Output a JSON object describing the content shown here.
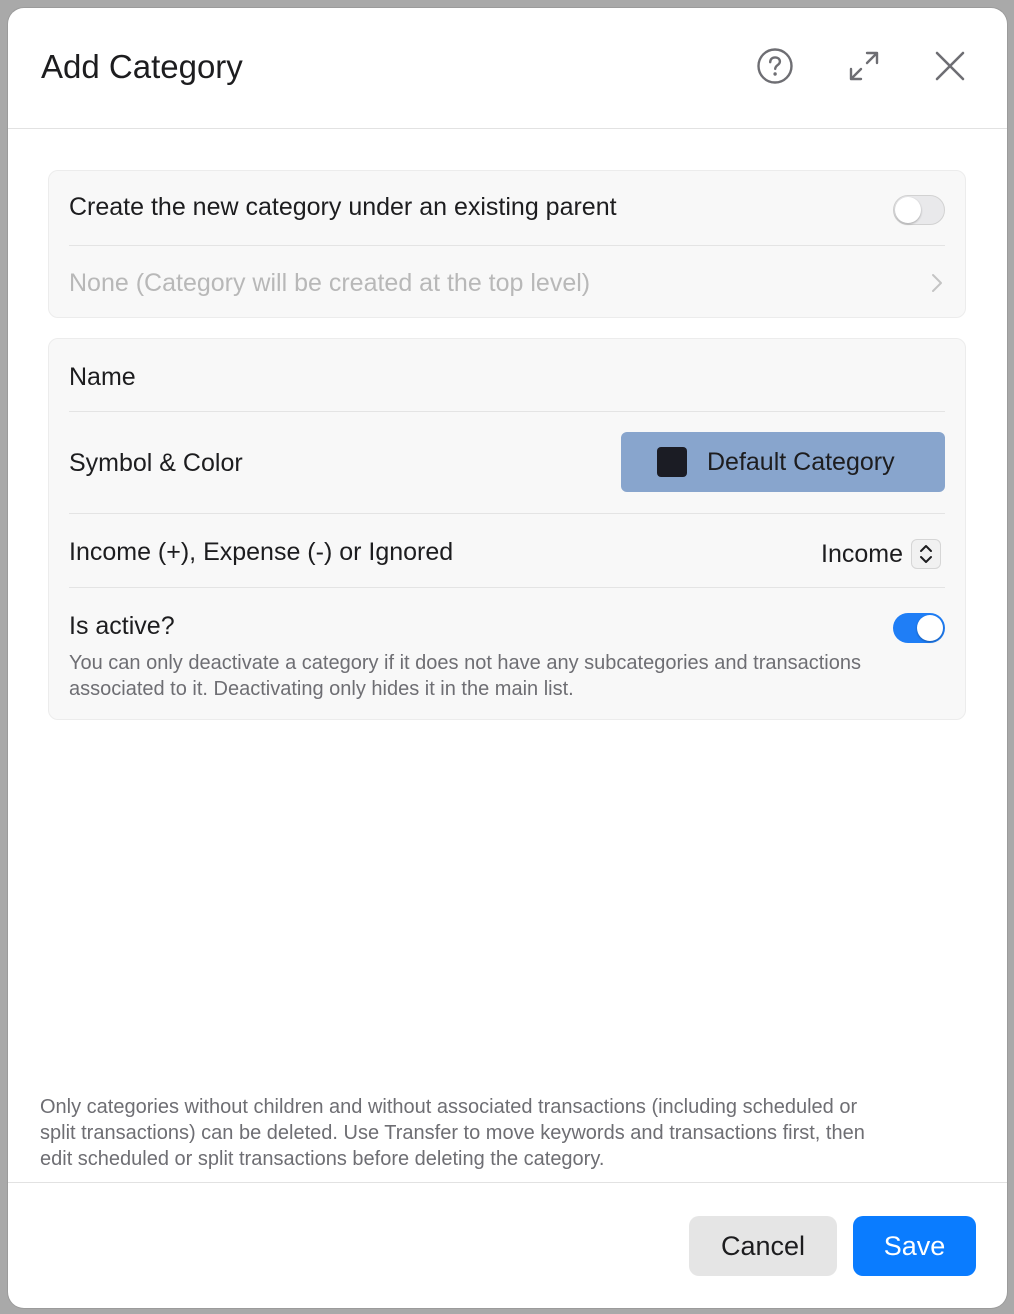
{
  "dialog": {
    "title": "Add Category",
    "icons": [
      "help-icon",
      "expand-icon",
      "close-icon"
    ]
  },
  "parent_section": {
    "toggle_label": "Create the new category under an existing parent",
    "toggle_on": false,
    "parent_value": "None (Category will be created at the top level)"
  },
  "details": {
    "name_label": "Name",
    "name_value": "",
    "symbol_label": "Symbol & Color",
    "symbol_button_label": "Default Category",
    "symbol_color": "#1b1c24",
    "button_color": "#88a5cd",
    "type_label": "Income (+), Expense (-) or Ignored",
    "type_value": "Income",
    "active_label": "Is active?",
    "active_on": true,
    "active_note_line1": "You can only deactivate a category if it does not have any subcategories and transactions",
    "active_note_line2": "associated to it. Deactivating only hides it in the main list."
  },
  "footer": {
    "delete_note_line1": "Only categories without children and without associated transactions (including scheduled or",
    "delete_note_line2": "split transactions) can be deleted. Use Transfer to move keywords and transactions first, then",
    "delete_note_line3": "edit scheduled or split transactions before deleting the category.",
    "cancel_label": "Cancel",
    "save_label": "Save"
  },
  "colors": {
    "accent": "#0a7cff",
    "toggle_on": "#1f7ef6"
  }
}
